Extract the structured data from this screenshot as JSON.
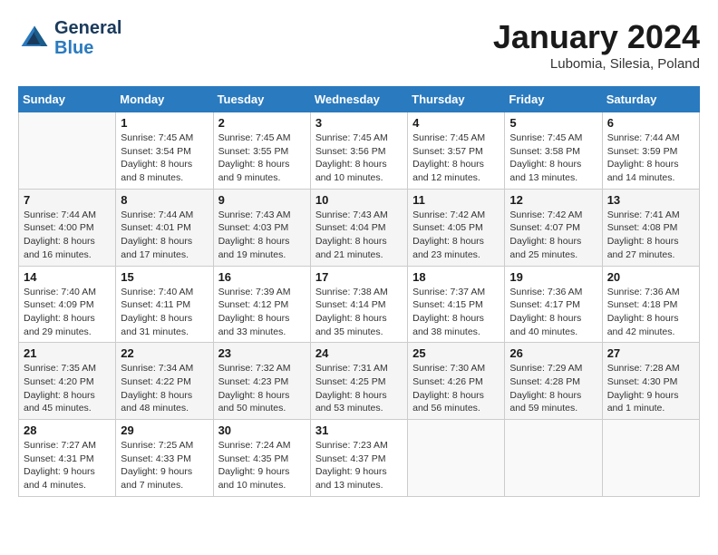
{
  "logo": {
    "line1": "General",
    "line2": "Blue"
  },
  "title": "January 2024",
  "subtitle": "Lubomia, Silesia, Poland",
  "days_of_week": [
    "Sunday",
    "Monday",
    "Tuesday",
    "Wednesday",
    "Thursday",
    "Friday",
    "Saturday"
  ],
  "weeks": [
    [
      {
        "day": "",
        "info": ""
      },
      {
        "day": "1",
        "info": "Sunrise: 7:45 AM\nSunset: 3:54 PM\nDaylight: 8 hours\nand 8 minutes."
      },
      {
        "day": "2",
        "info": "Sunrise: 7:45 AM\nSunset: 3:55 PM\nDaylight: 8 hours\nand 9 minutes."
      },
      {
        "day": "3",
        "info": "Sunrise: 7:45 AM\nSunset: 3:56 PM\nDaylight: 8 hours\nand 10 minutes."
      },
      {
        "day": "4",
        "info": "Sunrise: 7:45 AM\nSunset: 3:57 PM\nDaylight: 8 hours\nand 12 minutes."
      },
      {
        "day": "5",
        "info": "Sunrise: 7:45 AM\nSunset: 3:58 PM\nDaylight: 8 hours\nand 13 minutes."
      },
      {
        "day": "6",
        "info": "Sunrise: 7:44 AM\nSunset: 3:59 PM\nDaylight: 8 hours\nand 14 minutes."
      }
    ],
    [
      {
        "day": "7",
        "info": "Sunrise: 7:44 AM\nSunset: 4:00 PM\nDaylight: 8 hours\nand 16 minutes."
      },
      {
        "day": "8",
        "info": "Sunrise: 7:44 AM\nSunset: 4:01 PM\nDaylight: 8 hours\nand 17 minutes."
      },
      {
        "day": "9",
        "info": "Sunrise: 7:43 AM\nSunset: 4:03 PM\nDaylight: 8 hours\nand 19 minutes."
      },
      {
        "day": "10",
        "info": "Sunrise: 7:43 AM\nSunset: 4:04 PM\nDaylight: 8 hours\nand 21 minutes."
      },
      {
        "day": "11",
        "info": "Sunrise: 7:42 AM\nSunset: 4:05 PM\nDaylight: 8 hours\nand 23 minutes."
      },
      {
        "day": "12",
        "info": "Sunrise: 7:42 AM\nSunset: 4:07 PM\nDaylight: 8 hours\nand 25 minutes."
      },
      {
        "day": "13",
        "info": "Sunrise: 7:41 AM\nSunset: 4:08 PM\nDaylight: 8 hours\nand 27 minutes."
      }
    ],
    [
      {
        "day": "14",
        "info": "Sunrise: 7:40 AM\nSunset: 4:09 PM\nDaylight: 8 hours\nand 29 minutes."
      },
      {
        "day": "15",
        "info": "Sunrise: 7:40 AM\nSunset: 4:11 PM\nDaylight: 8 hours\nand 31 minutes."
      },
      {
        "day": "16",
        "info": "Sunrise: 7:39 AM\nSunset: 4:12 PM\nDaylight: 8 hours\nand 33 minutes."
      },
      {
        "day": "17",
        "info": "Sunrise: 7:38 AM\nSunset: 4:14 PM\nDaylight: 8 hours\nand 35 minutes."
      },
      {
        "day": "18",
        "info": "Sunrise: 7:37 AM\nSunset: 4:15 PM\nDaylight: 8 hours\nand 38 minutes."
      },
      {
        "day": "19",
        "info": "Sunrise: 7:36 AM\nSunset: 4:17 PM\nDaylight: 8 hours\nand 40 minutes."
      },
      {
        "day": "20",
        "info": "Sunrise: 7:36 AM\nSunset: 4:18 PM\nDaylight: 8 hours\nand 42 minutes."
      }
    ],
    [
      {
        "day": "21",
        "info": "Sunrise: 7:35 AM\nSunset: 4:20 PM\nDaylight: 8 hours\nand 45 minutes."
      },
      {
        "day": "22",
        "info": "Sunrise: 7:34 AM\nSunset: 4:22 PM\nDaylight: 8 hours\nand 48 minutes."
      },
      {
        "day": "23",
        "info": "Sunrise: 7:32 AM\nSunset: 4:23 PM\nDaylight: 8 hours\nand 50 minutes."
      },
      {
        "day": "24",
        "info": "Sunrise: 7:31 AM\nSunset: 4:25 PM\nDaylight: 8 hours\nand 53 minutes."
      },
      {
        "day": "25",
        "info": "Sunrise: 7:30 AM\nSunset: 4:26 PM\nDaylight: 8 hours\nand 56 minutes."
      },
      {
        "day": "26",
        "info": "Sunrise: 7:29 AM\nSunset: 4:28 PM\nDaylight: 8 hours\nand 59 minutes."
      },
      {
        "day": "27",
        "info": "Sunrise: 7:28 AM\nSunset: 4:30 PM\nDaylight: 9 hours\nand 1 minute."
      }
    ],
    [
      {
        "day": "28",
        "info": "Sunrise: 7:27 AM\nSunset: 4:31 PM\nDaylight: 9 hours\nand 4 minutes."
      },
      {
        "day": "29",
        "info": "Sunrise: 7:25 AM\nSunset: 4:33 PM\nDaylight: 9 hours\nand 7 minutes."
      },
      {
        "day": "30",
        "info": "Sunrise: 7:24 AM\nSunset: 4:35 PM\nDaylight: 9 hours\nand 10 minutes."
      },
      {
        "day": "31",
        "info": "Sunrise: 7:23 AM\nSunset: 4:37 PM\nDaylight: 9 hours\nand 13 minutes."
      },
      {
        "day": "",
        "info": ""
      },
      {
        "day": "",
        "info": ""
      },
      {
        "day": "",
        "info": ""
      }
    ]
  ]
}
